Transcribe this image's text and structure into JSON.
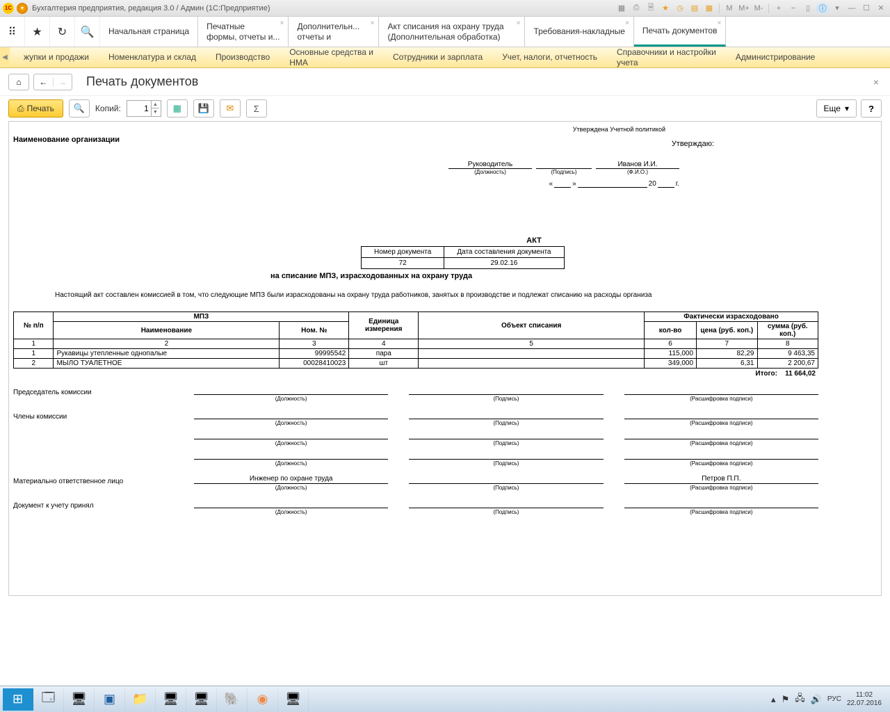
{
  "titlebar": {
    "title": "Бухгалтерия предприятия, редакция 3.0 / Админ  (1С:Предприятие)",
    "m": "M",
    "mplus": "M+",
    "mminus": "M-"
  },
  "tabs": {
    "home": "Начальная страница",
    "t1a": "Печатные",
    "t1b": "формы, отчеты и...",
    "t2a": "Дополнительн...",
    "t2b": "отчеты и",
    "t3a": "Акт списания на охрану труда",
    "t3b": "(Дополнительная обработка)",
    "t4": "Требования-накладные",
    "t5": "Печать документов"
  },
  "menu": {
    "m1": "жупки и продажи",
    "m2": "Номенклатура и склад",
    "m3": "Производство",
    "m4a": "Основные средства и",
    "m4b": "НМА",
    "m5": "Сотрудники и зарплата",
    "m6": "Учет, налоги, отчетность",
    "m7a": "Справочники и настройки",
    "m7b": "учета",
    "m8": "Администрирование"
  },
  "page": {
    "title": "Печать документов"
  },
  "toolbar": {
    "print": "Печать",
    "copies_label": "Копий:",
    "copies_value": "1",
    "more": "Еще",
    "help": "?"
  },
  "doc": {
    "approved_policy": "Утверждена Учетной политикой",
    "orgname": "Наименование организации",
    "approve": "Утверждаю:",
    "position": "Руководитель",
    "position_lbl": "(Должность)",
    "signature_lbl": "(Подпись)",
    "fio": "Иванов И.И.",
    "fio_lbl": "(Ф.И.О.)",
    "datequote_open": "«",
    "datequote_close": "»",
    "year20": "20",
    "year_g": "г.",
    "akt": "АКТ",
    "docnum_h": "Номер документа",
    "docdate_h": "Дата составления документа",
    "docnum": "72",
    "docdate": "29.02.16",
    "akt_sub": "на списание МПЗ, израсходованных на охрану труда",
    "descr": "Настоящий акт составлен комиссией в том, что следующие МПЗ были израсходованы на охрану труда работников, занятых в производстве и подлежат списанию на расходы организа",
    "th": {
      "num": "№ п/п",
      "mpz": "МПЗ",
      "name": "Наименование",
      "nom": "Ном. №",
      "unit": "Единица измерения",
      "obj": "Объект списания",
      "fact": "Фактически израсходовано",
      "qty": "кол-во",
      "price": "цена (руб. коп.)",
      "sum": "сумма (руб. коп.)"
    },
    "nums": {
      "c1": "1",
      "c2": "2",
      "c3": "3",
      "c4": "4",
      "c5": "5",
      "c6": "6",
      "c7": "7",
      "c8": "8"
    },
    "rows": [
      {
        "n": "1",
        "name": "Рукавицы утепленные однопалые",
        "nom": "99995542",
        "unit": "пара",
        "obj": "",
        "qty": "115,000",
        "price": "82,29",
        "sum": "9 463,35"
      },
      {
        "n": "2",
        "name": "МЫЛО ТУАЛЕТНОЕ",
        "nom": "00028410023",
        "unit": "шт",
        "obj": "",
        "qty": "349,000",
        "price": "6,31",
        "sum": "2 200,67"
      }
    ],
    "total_lbl": "Итого:",
    "total_val": "11 664,02",
    "comm": {
      "chair": "Председатель комиссии",
      "members": "Члены комиссии",
      "mat": "Материально ответственное лицо",
      "received": "Документ к учету принял",
      "pos_lbl": "(Должность)",
      "sig_lbl": "(Подпись)",
      "dec_lbl": "(Расшифровка подписи)",
      "engineer": "Инженер по охране труда",
      "petrov": "Петров П.П."
    }
  },
  "tray": {
    "lang": "РУС",
    "time": "11:02",
    "date": "22.07.2016"
  }
}
